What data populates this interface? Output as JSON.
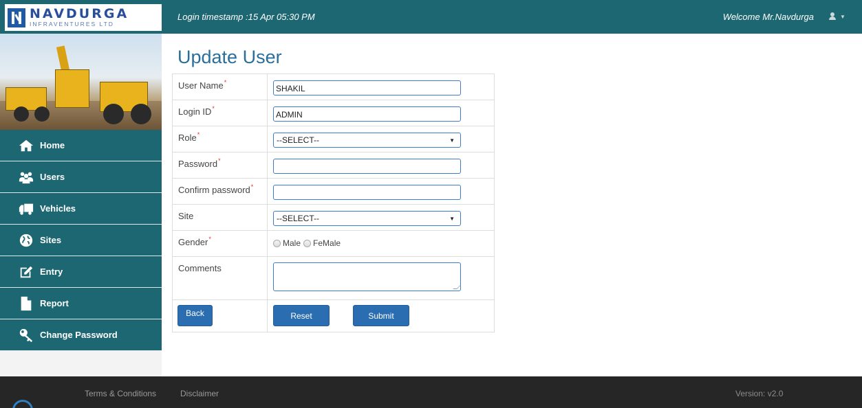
{
  "header": {
    "logo_name": "NAVDURGA",
    "logo_sub": "INFRAVENTURES LTD",
    "login_timestamp": "Login timestamp :15 Apr 05:30 PM",
    "welcome": "Welcome Mr.Navdurga",
    "user_icon": "user-icon",
    "menu_icon": "caret-down-icon"
  },
  "sidebar": {
    "items": [
      {
        "label": "Home",
        "icon": "home-icon"
      },
      {
        "label": "Users",
        "icon": "users-icon"
      },
      {
        "label": "Vehicles",
        "icon": "truck-icon"
      },
      {
        "label": "Sites",
        "icon": "globe-icon"
      },
      {
        "label": "Entry",
        "icon": "edit-icon"
      },
      {
        "label": "Report",
        "icon": "file-icon"
      },
      {
        "label": "Change Password",
        "icon": "key-icon"
      }
    ]
  },
  "form": {
    "title": "Update User",
    "required_mark": "*",
    "fields": {
      "user_name": {
        "label": "User Name",
        "value": "SHAKIL"
      },
      "login_id": {
        "label": "Login ID",
        "value": "ADMIN"
      },
      "role": {
        "label": "Role",
        "value": "--SELECT--"
      },
      "password": {
        "label": "Password",
        "value": ""
      },
      "confirm_password": {
        "label": "Confirm password",
        "value": ""
      },
      "site": {
        "label": "Site",
        "value": "--SELECT--"
      },
      "gender": {
        "label": "Gender",
        "options": [
          "Male",
          "FeMale"
        ]
      },
      "comments": {
        "label": "Comments",
        "value": ""
      }
    },
    "buttons": {
      "back": "Back",
      "reset": "Reset",
      "submit": "Submit"
    }
  },
  "footer": {
    "terms": "Terms & Conditions",
    "disclaimer": "Disclaimer",
    "version": "Version: v2.0"
  },
  "colors": {
    "header_bg": "#1d6773",
    "nav_bg": "#1d6773",
    "title": "#2a6e9a",
    "button": "#2a6db0",
    "input_border": "#3d7cc9",
    "required": "#e03333",
    "footer_bg": "#262626"
  }
}
